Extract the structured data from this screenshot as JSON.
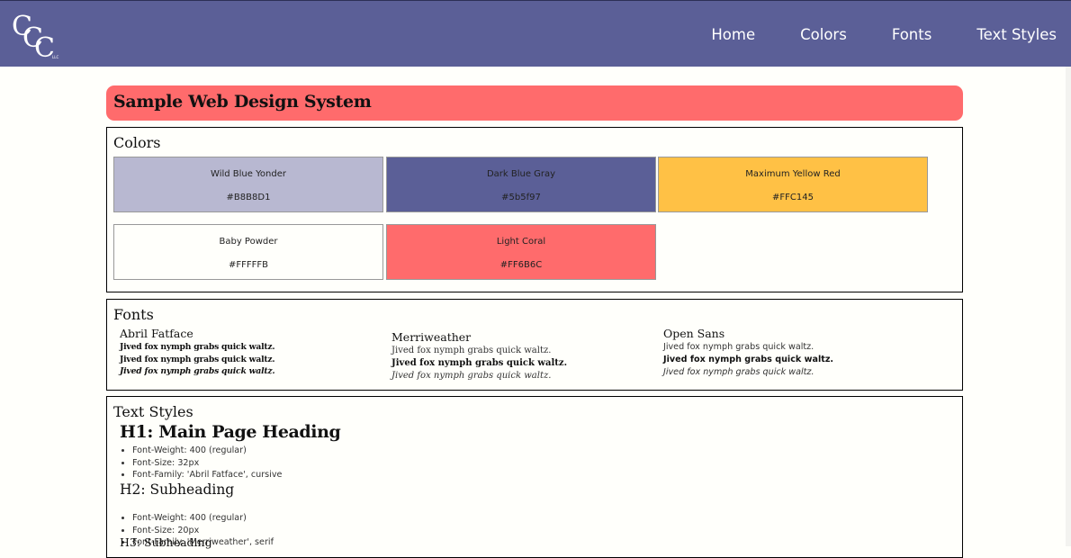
{
  "nav": {
    "logo_letters": [
      "C",
      "C",
      "C"
    ],
    "logo_small": "LLC",
    "links": [
      "Home",
      "Colors",
      "Fonts",
      "Text Styles"
    ]
  },
  "banner": {
    "title": "Sample Web Design System"
  },
  "colors": {
    "title": "Colors",
    "swatches": [
      {
        "name": "Wild Blue Yonder",
        "hex": "#B8B8D1",
        "color": "#B8B8D1"
      },
      {
        "name": "Dark Blue Gray",
        "hex": "#5b5f97",
        "color": "#5B5F97"
      },
      {
        "name": "Maximum Yellow Red",
        "hex": "#FFC145",
        "color": "#FFC145"
      },
      {
        "name": "Baby Powder",
        "hex": "#FFFFFB",
        "color": "#FFFFFB"
      },
      {
        "name": "Light Coral",
        "hex": "#FF6B6C",
        "color": "#FF6B6C"
      }
    ]
  },
  "fonts": {
    "title": "Fonts",
    "sample": "Jived fox nymph grabs quick waltz.",
    "families": [
      {
        "name": "Abril Fatface"
      },
      {
        "name": "Merriweather"
      },
      {
        "name": "Open Sans"
      }
    ]
  },
  "text_styles": {
    "title": "Text Styles",
    "h1": {
      "label": "H1: Main Page Heading",
      "props": [
        "Font-Weight: 400 (regular)",
        "Font-Size: 32px",
        "Font-Family: 'Abril Fatface', cursive"
      ]
    },
    "h2": {
      "label": "H2: Subheading",
      "props": [
        "Font-Weight: 400 (regular)",
        "Font-Size: 20px",
        "Font-Family: 'Merriweather', serif"
      ]
    },
    "h3": {
      "label": "H3: Subheading"
    }
  }
}
